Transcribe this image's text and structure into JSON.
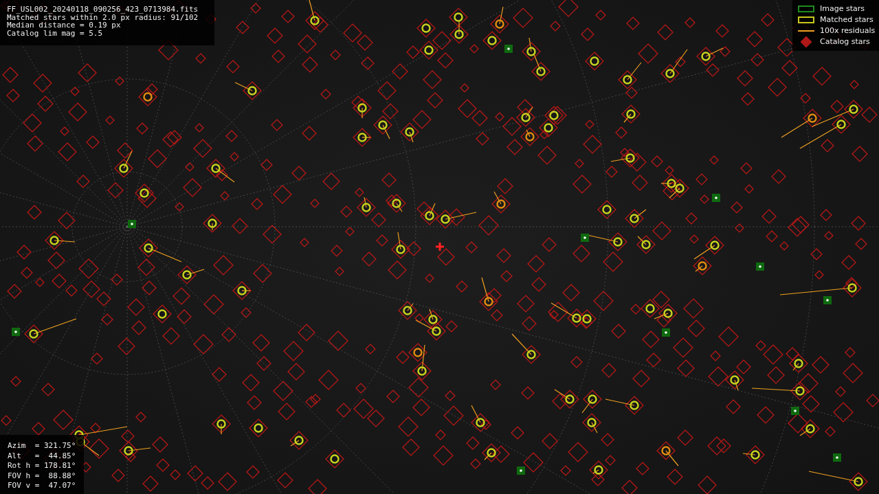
{
  "info_lines": [
    "FF_USL002_20240118_090256_423_0713984.fits",
    "Matched stars within 2.0 px radius: 91/102",
    "Median distance = 0.19 px",
    "Catalog lim mag = 5.5"
  ],
  "legend": [
    {
      "kind": "box",
      "color": "#1f8a1f",
      "label": "Image stars"
    },
    {
      "kind": "box",
      "color": "#c8c81e",
      "label": "Matched stars"
    },
    {
      "kind": "line",
      "color": "#f0a020",
      "label": "100x residuals"
    },
    {
      "kind": "diamond",
      "color": "#b01818",
      "label": "Catalog stars"
    }
  ],
  "pointing_lines": [
    "Azim  = 321.75°",
    "Alt   =  44.85°",
    "Rot h = 178.81°",
    "FOV h =  88.88°",
    "FOV v =  47.07°"
  ]
}
